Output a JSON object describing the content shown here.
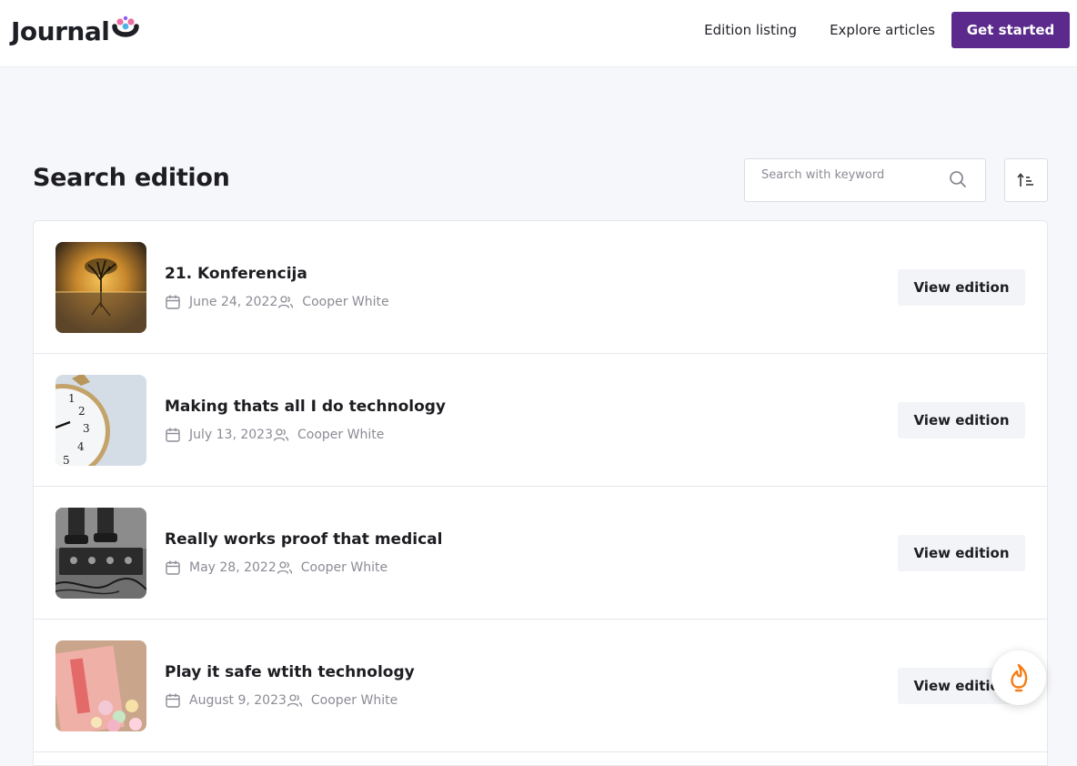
{
  "brand": {
    "name": "Journal",
    "icon": "smile-dots-logo-icon",
    "colors": {
      "dark": "#1e1f24",
      "pink": "#ec6fa5",
      "blue": "#4fb3e8",
      "purple": "#8b5cf6"
    }
  },
  "nav": {
    "links": [
      "Edition listing",
      "Explore articles"
    ],
    "cta": "Get started",
    "cta_color": "#5b2a8c"
  },
  "page": {
    "title": "Search edition"
  },
  "search": {
    "placeholder": "Search with keyword",
    "value": "",
    "icon": "search-icon"
  },
  "sort": {
    "icon": "sort-ascending-icon"
  },
  "editions": [
    {
      "title": "21. Konferencija",
      "date": "June 24, 2022",
      "author": "Cooper White",
      "button": "View edition",
      "thumb": "tree-reflection-sunset"
    },
    {
      "title": "Making thats all I do technology",
      "date": "July 13, 2023",
      "author": "Cooper White",
      "button": "View edition",
      "thumb": "clock-face"
    },
    {
      "title": "Really works proof that medical",
      "date": "May 28, 2022",
      "author": "Cooper White",
      "button": "View edition",
      "thumb": "boots-guitar-pedals"
    },
    {
      "title": "Play it safe wtith technology",
      "date": "August 9, 2023",
      "author": "Cooper White",
      "button": "View edition",
      "thumb": "candy-hearts"
    }
  ],
  "meta_icons": {
    "date": "calendar-icon",
    "author": "users-icon"
  },
  "float": {
    "icon": "hand-flame-icon",
    "color": "#f57c14"
  }
}
